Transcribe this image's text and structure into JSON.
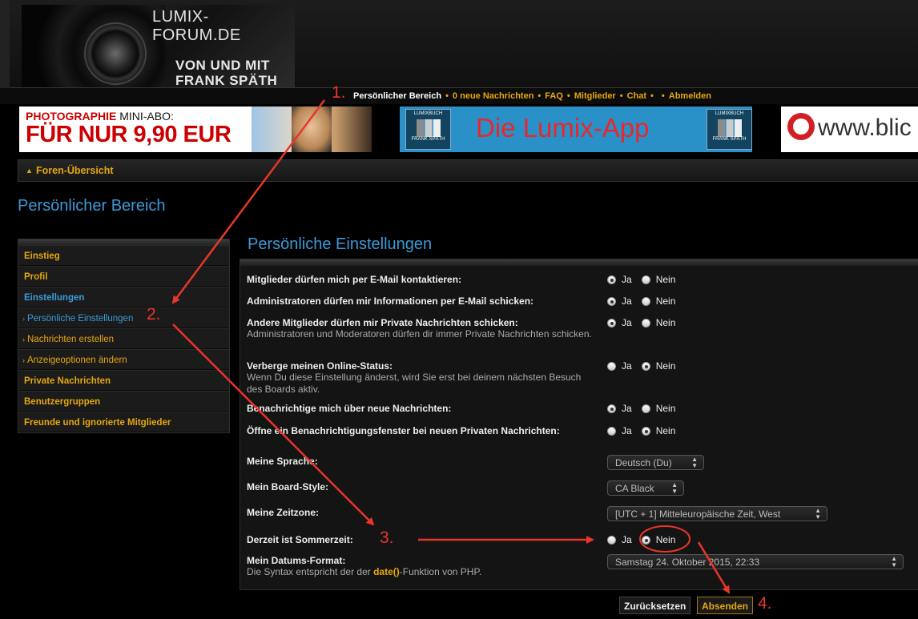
{
  "header": {
    "site_name": "LUMIX-FORUM.DE",
    "tagline_1": "VON UND MIT",
    "tagline_2": "FRANK SPÄTH"
  },
  "nav": {
    "personal_area": "Persönlicher Bereich",
    "new_count": "0",
    "new_messages": "neue Nachrichten",
    "faq": "FAQ",
    "members": "Mitglieder",
    "chat": "Chat",
    "logout": "Abmelden"
  },
  "banners": {
    "b1_top_red": "PHOTOGRAPHIE",
    "b1_top_dark": " MINI-ABO:",
    "b1_main": "FÜR NUR 9,90 EUR",
    "b2_logo_top": "LUMIXBUCH",
    "b2_logo_bottom": "FRANK SPÄTH",
    "b2_text": "Die Lumix-App",
    "b3_text": "www.blic"
  },
  "breadcrumb": {
    "label": "Foren-Übersicht"
  },
  "page_title": "Persönlicher Bereich",
  "sidebar": {
    "items": [
      {
        "label": "Einstieg"
      },
      {
        "label": "Profil"
      },
      {
        "label": "Einstellungen"
      },
      {
        "label": "Persönliche Einstellungen"
      },
      {
        "label": "Nachrichten erstellen"
      },
      {
        "label": "Anzeigeoptionen ändern"
      },
      {
        "label": "Private Nachrichten"
      },
      {
        "label": "Benutzergruppen"
      },
      {
        "label": "Freunde und ignorierte Mitglieder"
      }
    ]
  },
  "panel": {
    "title": "Persönliche Einstellungen",
    "yes": "Ja",
    "no": "Nein",
    "settings": [
      {
        "label": "Mitglieder dürfen mich per E-Mail kontaktieren:",
        "desc": "",
        "selected": "Ja"
      },
      {
        "label": "Administratoren dürfen mir Informationen per E-Mail schicken:",
        "desc": "",
        "selected": "Ja"
      },
      {
        "label": "Andere Mitglieder dürfen mir Private Nachrichten schicken:",
        "desc": "Administratoren und Moderatoren dürfen dir immer Private Nachrichten schicken.",
        "selected": "Ja"
      },
      {
        "label": "Verberge meinen Online-Status:",
        "desc": "Wenn Du diese Einstellung änderst, wird Sie erst bei deinem nächsten Besuch des Boards aktiv.",
        "selected": "Nein"
      },
      {
        "label": "Benachrichtige mich über neue Nachrichten:",
        "desc": "",
        "selected": "Ja"
      },
      {
        "label": "Öffne ein Benachrichtigungsfenster bei neuen Privaten Nachrichten:",
        "desc": "",
        "selected": "Nein"
      },
      {
        "label": "Meine Sprache:",
        "value": "Deutsch (Du)"
      },
      {
        "label": "Mein Board-Style:",
        "value": "CA Black"
      },
      {
        "label": "Meine Zeitzone:",
        "value": "[UTC + 1] Mitteleuropäische Zeit, West"
      },
      {
        "label": "Derzeit ist Sommerzeit:",
        "desc": "",
        "selected": "Nein"
      },
      {
        "label": "Mein Datums-Format:",
        "desc_pre": "Die Syntax entspricht der der ",
        "desc_fn": "date()",
        "desc_post": "-Funktion von PHP.",
        "value": "Samstag 24. Oktober 2015, 22:33"
      }
    ],
    "reset_button": "Zurücksetzen",
    "submit_button": "Absenden"
  },
  "annotations": {
    "step1": "1.",
    "step2": "2.",
    "step3": "3.",
    "step4": "4.",
    "color": "#e8362a"
  },
  "colors": {
    "accent_gold": "#e5a70e",
    "accent_blue": "#3c9ad8",
    "background": "#000000"
  }
}
